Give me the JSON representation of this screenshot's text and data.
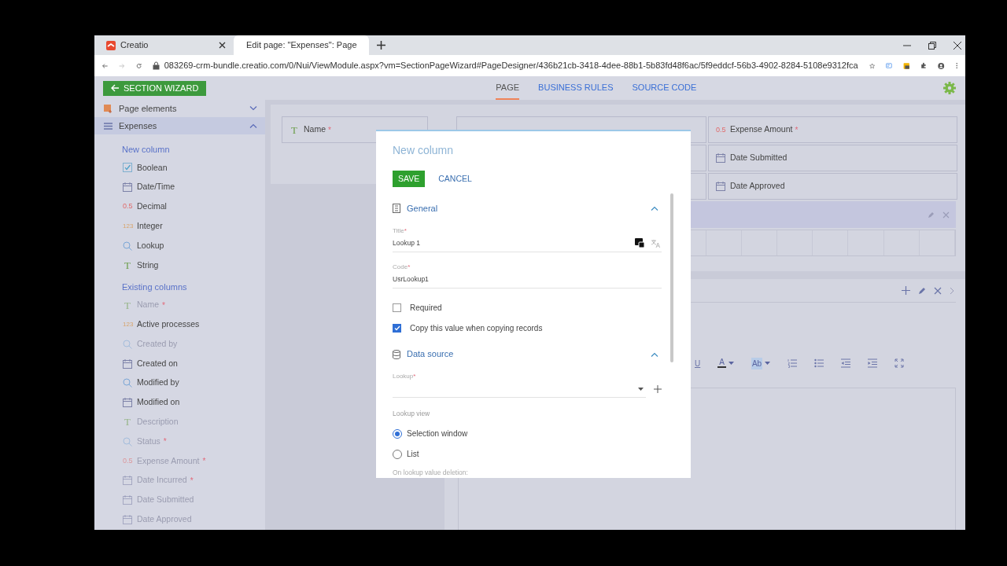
{
  "browser": {
    "tabs": [
      {
        "title": "Creatio",
        "selected": false
      },
      {
        "title": "Edit page: \"Expenses\": Page",
        "selected": true
      }
    ],
    "url": "083269-crm-bundle.creatio.com/0/Nui/ViewModule.aspx?vm=SectionPageWizard#PageDesigner/436b21cb-3418-4dee-88b1-5b83fd48f6ac/5f9eddcf-56b3-4902-8284-5108e9312fca"
  },
  "header": {
    "back_button": "SECTION WIZARD",
    "tabs": [
      {
        "label": "PAGE",
        "selected": true
      },
      {
        "label": "BUSINESS RULES",
        "selected": false
      },
      {
        "label": "SOURCE CODE",
        "selected": false
      }
    ]
  },
  "sidebar": {
    "groups": [
      {
        "label": "Page elements",
        "expanded": false,
        "selected": false
      },
      {
        "label": "Expenses",
        "expanded": true,
        "selected": true
      }
    ],
    "sections": [
      {
        "title": "New column",
        "items": [
          {
            "kind": "boolean",
            "label": "Boolean",
            "disabled": false
          },
          {
            "kind": "datetime",
            "label": "Date/Time",
            "disabled": false
          },
          {
            "kind": "decimal",
            "glyph": "0.5",
            "label": "Decimal",
            "disabled": false
          },
          {
            "kind": "integer",
            "glyph": "123",
            "label": "Integer",
            "disabled": false
          },
          {
            "kind": "lookup",
            "label": "Lookup",
            "disabled": false
          },
          {
            "kind": "string",
            "glyph": "T",
            "label": "String",
            "disabled": false
          }
        ]
      },
      {
        "title": "Existing columns",
        "items": [
          {
            "kind": "string",
            "glyph": "T",
            "label": "Name",
            "required_mark": "*",
            "disabled": true
          },
          {
            "kind": "integer",
            "glyph": "123",
            "label": "Active processes",
            "disabled": false
          },
          {
            "kind": "lookup",
            "label": "Created by",
            "disabled": true
          },
          {
            "kind": "datetime",
            "label": "Created on",
            "disabled": false
          },
          {
            "kind": "lookup",
            "label": "Modified by",
            "disabled": false
          },
          {
            "kind": "datetime",
            "label": "Modified on",
            "disabled": false
          },
          {
            "kind": "string",
            "glyph": "T",
            "label": "Description",
            "disabled": true
          },
          {
            "kind": "lookup",
            "label": "Status",
            "required_mark": "*",
            "disabled": true
          },
          {
            "kind": "decimal",
            "glyph": "0.5",
            "label": "Expense Amount",
            "required_mark": "*",
            "disabled": true
          },
          {
            "kind": "datetime",
            "label": "Date Incurred",
            "required_mark": "*",
            "disabled": true
          },
          {
            "kind": "datetime",
            "label": "Date Submitted",
            "disabled": true
          },
          {
            "kind": "datetime",
            "label": "Date Approved",
            "disabled": true
          }
        ]
      }
    ]
  },
  "canvas": {
    "left_fields": [
      {
        "kind": "string",
        "glyph": "T",
        "label": "Name",
        "required_mark": "*"
      }
    ],
    "right_fields": [
      {
        "kind": "decimal",
        "glyph": "0.5",
        "label": "Expense Amount",
        "required_mark": "*"
      },
      {
        "kind": "datetime",
        "label": "Date Submitted"
      },
      {
        "kind": "datetime",
        "label": "Date Approved"
      }
    ],
    "toolbar": [
      {
        "kind": "underline",
        "glyph": "U"
      },
      {
        "kind": "text-color",
        "glyph": "A"
      },
      {
        "kind": "highlight",
        "glyph": "Ab"
      },
      {
        "kind": "numbered-list"
      },
      {
        "kind": "bullet-list"
      },
      {
        "kind": "outdent"
      },
      {
        "kind": "indent"
      },
      {
        "kind": "fullscreen"
      }
    ]
  },
  "modal": {
    "title": "New column",
    "buttons": [
      {
        "kind": "primary",
        "label": "SAVE"
      },
      {
        "kind": "link",
        "label": "CANCEL"
      }
    ],
    "sections": [
      {
        "kind": "general",
        "title": "General",
        "expanded": true
      },
      {
        "kind": "data-source",
        "title": "Data source",
        "expanded": true
      }
    ],
    "fields": [
      {
        "label": "Title",
        "required_mark": "*",
        "value": "Lookup 1",
        "localizable": true
      },
      {
        "label": "Code",
        "required_mark": "*",
        "value": "UsrLookup1",
        "localizable": false
      }
    ],
    "checkboxes": [
      {
        "label": "Required",
        "checked": false
      },
      {
        "label": "Copy this value when copying records",
        "checked": true
      }
    ],
    "lookup_field": {
      "label": "Lookup",
      "required_mark": "*"
    },
    "lookup_view": {
      "label": "Lookup view",
      "options": [
        {
          "label": "Selection window",
          "selected": true
        },
        {
          "label": "List",
          "selected": false
        }
      ]
    },
    "deletion_label": "On lookup value deletion:"
  }
}
